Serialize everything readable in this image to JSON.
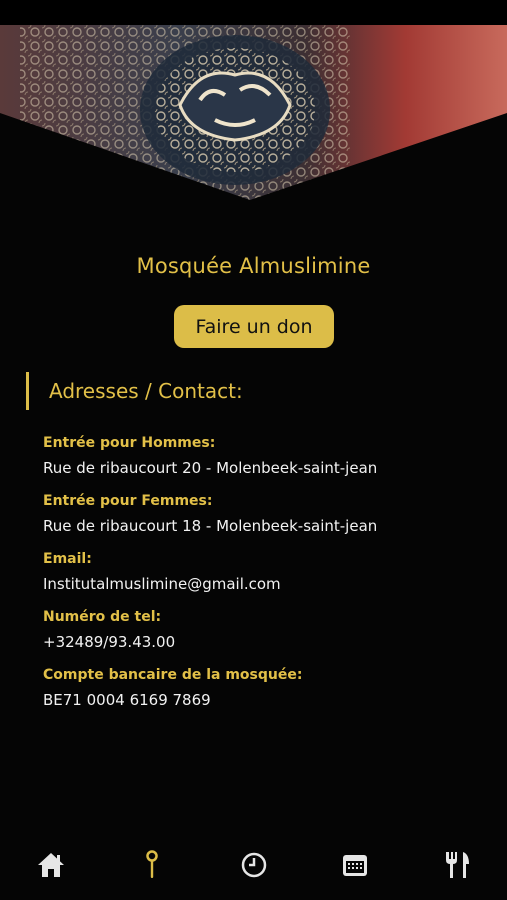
{
  "app": {
    "mosque_name": "Mosquée Almuslimine"
  },
  "colors": {
    "accent": "#dcbd48",
    "background": "#050505"
  },
  "donate_button": {
    "label": "Faire un don"
  },
  "section": {
    "title": "Adresses / Contact:"
  },
  "contacts": [
    {
      "label": "Entrée pour Hommes:",
      "value": "Rue de ribaucourt 20 - Molenbeek-saint-jean"
    },
    {
      "label": "Entrée pour Femmes:",
      "value": "Rue de ribaucourt 18 - Molenbeek-saint-jean"
    },
    {
      "label": "Email:",
      "value": "Institutalmuslimine@gmail.com"
    },
    {
      "label": "Numéro de tel:",
      "value": "+32489/93.43.00"
    },
    {
      "label": "Compte bancaire de la mosquée:",
      "value": "BE71 0004 6169 7869"
    }
  ],
  "tabbar": {
    "tabs": [
      {
        "icon": "home-icon",
        "active": false
      },
      {
        "icon": "location-pin-icon",
        "active": true
      },
      {
        "icon": "clock-icon",
        "active": false
      },
      {
        "icon": "calendar-icon",
        "active": false
      },
      {
        "icon": "fork-knife-icon",
        "active": false
      }
    ]
  }
}
